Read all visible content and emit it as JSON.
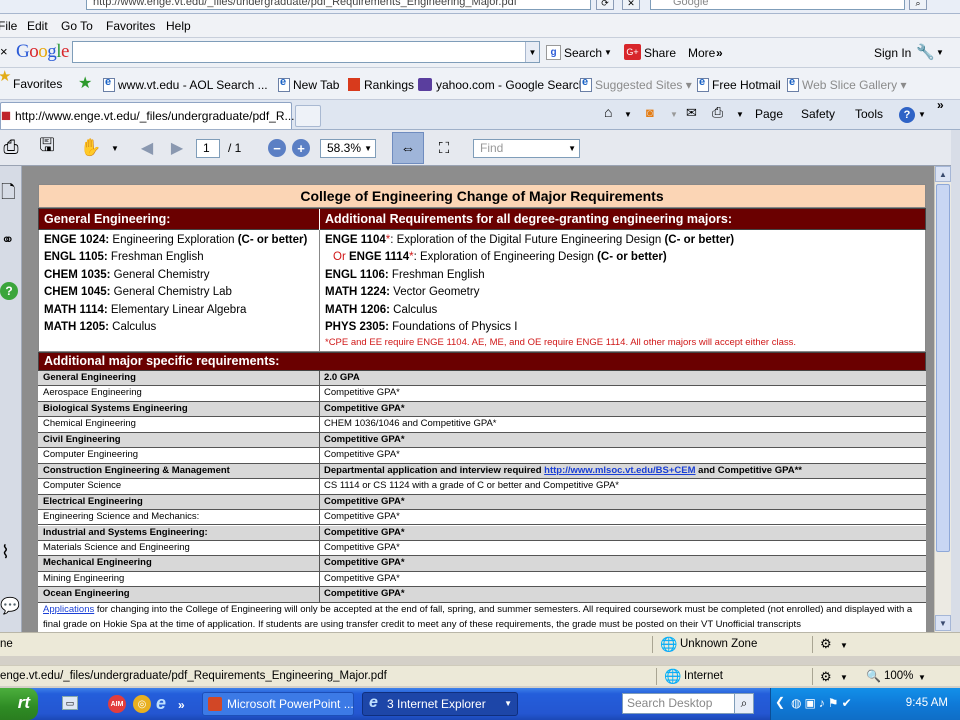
{
  "top_strip": {
    "address_fragment": "http://www.enge.vt.edu/_files/undergraduate/pdf_Requirements_Engineering_Major.pdf",
    "search_engine": "Google"
  },
  "menu": {
    "file": "File",
    "edit": "Edit",
    "goto": "Go To",
    "favorites": "Favorites",
    "help": "Help"
  },
  "google_toolbar": {
    "logo": "Google",
    "search_label": "Search",
    "share_label": "Share",
    "more_label": "More",
    "signin_label": "Sign In"
  },
  "favorites_bar": {
    "favorites_label": "Favorites",
    "items": [
      "www.vt.edu - AOL Search ...",
      "New Tab",
      "Rankings",
      "yahoo.com - Google Search",
      "Suggested Sites",
      "Free Hotmail",
      "Web Slice Gallery"
    ]
  },
  "tab": {
    "title": "http://www.enge.vt.edu/_files/undergraduate/pdf_R..."
  },
  "command_bar": {
    "page": "Page",
    "safety": "Safety",
    "tools": "Tools"
  },
  "pdf_toolbar": {
    "page_current": "1",
    "page_total": "/ 1",
    "zoom": "58.3%",
    "find_placeholder": "Find"
  },
  "document": {
    "title": "College of Engineering Change of Major Requirements",
    "general_heading": "General Engineering:",
    "additional_heading": "Additional Requirements for all degree-granting engineering majors:",
    "general_courses": [
      {
        "code": "ENGE 1024:",
        "name": " Engineering Exploration ",
        "grade": "(C- or better)"
      },
      {
        "code": "ENGL 1105:",
        "name": " Freshman English",
        "grade": ""
      },
      {
        "code": "CHEM 1035:",
        "name": " General Chemistry",
        "grade": ""
      },
      {
        "code": "CHEM 1045:",
        "name": " General Chemistry Lab",
        "grade": ""
      },
      {
        "code": "MATH 1114:",
        "name": " Elementary Linear Algebra",
        "grade": ""
      },
      {
        "code": "MATH 1205:",
        "name": " Calculus",
        "grade": ""
      }
    ],
    "additional_courses": [
      {
        "prefix": "",
        "code": "ENGE 1104",
        "star": "*",
        "name": ": Exploration of the Digital Future Engineering Design ",
        "grade": "(C- or better)"
      },
      {
        "prefix": "Or ",
        "code": "ENGE 1114",
        "star": "*",
        "name": ": Exploration of Engineering Design ",
        "grade": "(C- or better)"
      },
      {
        "prefix": "",
        "code": "ENGL 1106:",
        "star": "",
        "name": " Freshman English",
        "grade": ""
      },
      {
        "prefix": "",
        "code": "MATH 1224:",
        "star": "",
        "name": " Vector Geometry",
        "grade": ""
      },
      {
        "prefix": "",
        "code": "MATH 1206:",
        "star": "",
        "name": " Calculus",
        "grade": ""
      },
      {
        "prefix": "",
        "code": "PHYS 2305:",
        "star": "",
        "name": " Foundations of Physics I",
        "grade": ""
      }
    ],
    "additional_note": "*CPE and EE require ENGE 1104. AE, ME, and OE require ENGE 1114. All other majors will accept either class.",
    "major_heading": "Additional major specific requirements:",
    "majors": [
      {
        "major": "General Engineering",
        "req": "2.0 GPA"
      },
      {
        "major": "Aerospace Engineering",
        "req": "Competitive GPA*"
      },
      {
        "major": "Biological Systems Engineering",
        "req": "Competitive GPA*"
      },
      {
        "major": "Chemical Engineering",
        "req": "CHEM 1036/1046 and Competitive GPA*"
      },
      {
        "major": "Civil Engineering",
        "req": "Competitive GPA*"
      },
      {
        "major": "Computer Engineering",
        "req": "Competitive GPA*"
      },
      {
        "major": "Construction Engineering & Management",
        "req": "Departmental application and interview required ",
        "link": "http://www.mlsoc.vt.edu/BS+CEM",
        "req_after": "  and  Competitive GPA**"
      },
      {
        "major": "Computer Science",
        "req": "CS 1114 or CS 1124 with a grade of C or better and Competitive GPA*"
      },
      {
        "major": "Electrical Engineering",
        "req": "Competitive GPA*"
      },
      {
        "major": "Engineering Science and Mechanics:",
        "req": "Competitive GPA*"
      },
      {
        "major": "Industrial and Systems Engineering:",
        "req": "Competitive GPA*"
      },
      {
        "major": "Materials Science and Engineering",
        "req": "Competitive GPA*"
      },
      {
        "major": "Mechanical Engineering",
        "req": "Competitive GPA*"
      },
      {
        "major": "Mining Engineering",
        "req": "Competitive GPA*"
      },
      {
        "major": "Ocean Engineering",
        "req": "Competitive GPA*"
      }
    ],
    "footer_link": "Applications",
    "footer_text": " for changing into the College of Engineering will only be accepted at the end of fall, spring, and summer semesters.  All required coursework must be completed (not enrolled) and displayed with a final grade on Hokie Spa at the time of application.  If students are using transfer credit to meet any of these requirements, the grade must be posted on their VT Unofficial transcripts"
  },
  "status_bar": {
    "left": "ne",
    "zone": "Unknown Zone"
  },
  "address_status": {
    "url": "enge.vt.edu/_files/undergraduate/pdf_Requirements_Engineering_Major.pdf",
    "zone": "Internet",
    "zoom": "100%"
  },
  "taskbar": {
    "start": "rt",
    "task1": "Microsoft PowerPoint ...",
    "task2": "3 Internet Explorer",
    "search_placeholder": "Search Desktop",
    "clock": "9:45 AM"
  },
  "colors": {
    "header_maroon": "#6a0000",
    "title_peach": "#fbd5b5",
    "note_red": "#d01818",
    "taskbar_blue": "#245edb"
  }
}
